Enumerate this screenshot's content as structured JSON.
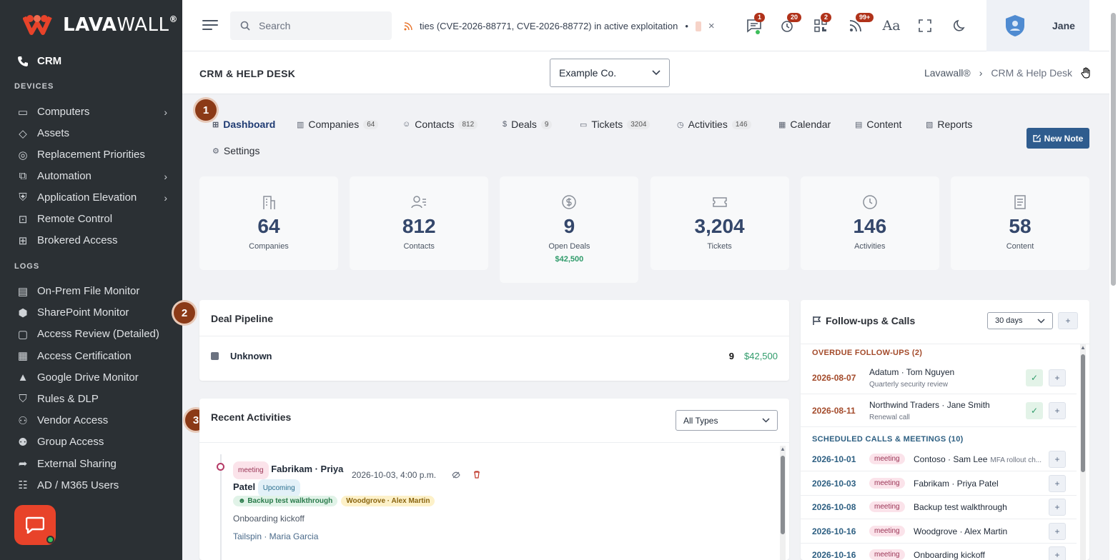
{
  "brand": {
    "name_lava": "LAVA",
    "name_wall": "WALL",
    "reg": "®"
  },
  "sidebar": {
    "crm_label": "CRM",
    "devices_heading": "DEVICES",
    "devices": [
      {
        "label": "Computers",
        "icon": "monitor-icon",
        "chevron": true
      },
      {
        "label": "Assets",
        "icon": "tag-icon",
        "chevron": false
      },
      {
        "label": "Replacement Priorities",
        "icon": "cycle-icon",
        "chevron": false
      },
      {
        "label": "Automation",
        "icon": "automation-icon",
        "chevron": true
      },
      {
        "label": "Application Elevation",
        "icon": "shield-icon",
        "chevron": true
      },
      {
        "label": "Remote Control",
        "icon": "remote-icon",
        "chevron": false
      },
      {
        "label": "Brokered Access",
        "icon": "network-icon",
        "chevron": false
      }
    ],
    "logs_heading": "LOGS",
    "logs": [
      {
        "label": "On-Prem File Monitor",
        "icon": "file-server-icon"
      },
      {
        "label": "SharePoint Monitor",
        "icon": "sharepoint-icon"
      },
      {
        "label": "Access Review (Detailed)",
        "icon": "folder-search-icon"
      },
      {
        "label": "Access Certification",
        "icon": "certificate-icon"
      },
      {
        "label": "Google Drive Monitor",
        "icon": "drive-icon"
      },
      {
        "label": "Rules & DLP",
        "icon": "shield-outline-icon"
      },
      {
        "label": "Vendor Access",
        "icon": "users-icon"
      },
      {
        "label": "Group Access",
        "icon": "group-icon"
      },
      {
        "label": "External Sharing",
        "icon": "share-icon"
      },
      {
        "label": "AD / M365 Users",
        "icon": "directory-icon"
      }
    ]
  },
  "topbar": {
    "search_placeholder": "Search",
    "ticker_text": "ties (CVE-2026-88771, CVE-2026-88772) in active exploitation",
    "ticker_sep": "•",
    "ticker_close": "×",
    "badges": {
      "messages": "1",
      "timer": "20",
      "qr": "2",
      "rss": "99+"
    },
    "user_name": "Jane"
  },
  "page": {
    "title": "CRM & HELP DESK",
    "company": "Example Co.",
    "breadcrumb_root": "Lavawall®",
    "breadcrumb_sep": "›",
    "breadcrumb_current": "CRM & Help Desk"
  },
  "steps": [
    "1",
    "2",
    "3"
  ],
  "tabs": [
    {
      "label": "Dashboard",
      "count": "",
      "icon": "dashboard-icon"
    },
    {
      "label": "Companies",
      "count": "64",
      "icon": "building-icon"
    },
    {
      "label": "Contacts",
      "count": "812",
      "icon": "contacts-icon"
    },
    {
      "label": "Deals",
      "count": "9",
      "icon": "dollar-icon"
    },
    {
      "label": "Tickets",
      "count": "3204",
      "icon": "ticket-icon"
    },
    {
      "label": "Activities",
      "count": "146",
      "icon": "clock-icon"
    },
    {
      "label": "Calendar",
      "count": "",
      "icon": "calendar-icon"
    },
    {
      "label": "Content",
      "count": "",
      "icon": "document-icon"
    },
    {
      "label": "Reports",
      "count": "",
      "icon": "report-icon"
    },
    {
      "label": "Settings",
      "count": "",
      "icon": "gear-icon"
    }
  ],
  "new_note": "New Note",
  "stats": [
    {
      "num": "64",
      "label": "Companies",
      "amount": ""
    },
    {
      "num": "812",
      "label": "Contacts",
      "amount": ""
    },
    {
      "num": "9",
      "label": "Open Deals",
      "amount": "$42,500"
    },
    {
      "num": "3,204",
      "label": "Tickets",
      "amount": ""
    },
    {
      "num": "146",
      "label": "Activities",
      "amount": ""
    },
    {
      "num": "58",
      "label": "Content",
      "amount": ""
    }
  ],
  "pipeline": {
    "title": "Deal Pipeline",
    "rows": [
      {
        "stage": "Unknown",
        "count": "9",
        "value": "$42,500"
      }
    ]
  },
  "recent": {
    "title": "Recent Activities",
    "filter": "All Types",
    "item": {
      "type": "meeting",
      "title": "Fabrikam · Priya Patel",
      "when": "2026-10-03, 4:00 p.m.",
      "status": "Upcoming",
      "tag1": "Backup test walkthrough",
      "tag2": "Woodgrove · Alex Martin",
      "desc": "Onboarding kickoff",
      "link": "Tailspin · Maria Garcia"
    }
  },
  "followups": {
    "title": "Follow-ups & Calls",
    "range": "30 days",
    "overdue_heading": "OVERDUE FOLLOW-UPS (2)",
    "overdue": [
      {
        "date": "2026-08-07",
        "who": "Adatum · Tom Nguyen",
        "note": "Quarterly security review"
      },
      {
        "date": "2026-08-11",
        "who": "Northwind Traders · Jane Smith",
        "note": "Renewal call"
      }
    ],
    "scheduled_heading": "SCHEDULED CALLS & MEETINGS (10)",
    "scheduled": [
      {
        "date": "2026-10-01",
        "type": "meeting",
        "who": "Contoso · Sam Lee",
        "note": "MFA rollout ch..."
      },
      {
        "date": "2026-10-03",
        "type": "meeting",
        "who": "Fabrikam · Priya Patel",
        "note": ""
      },
      {
        "date": "2026-10-08",
        "type": "meeting",
        "who": "Backup test walkthrough",
        "note": ""
      },
      {
        "date": "2026-10-16",
        "type": "meeting",
        "who": "Woodgrove · Alex Martin",
        "note": ""
      },
      {
        "date": "2026-10-16",
        "type": "meeting",
        "who": "Onboarding kickoff",
        "note": ""
      }
    ]
  },
  "colors": {
    "sidebar": "#2b3034",
    "accent": "#2f5c8e",
    "brand": "#e8432a",
    "overdue": "#a34a2a",
    "scheduled": "#2d5f82",
    "money": "#2f9b6a"
  }
}
